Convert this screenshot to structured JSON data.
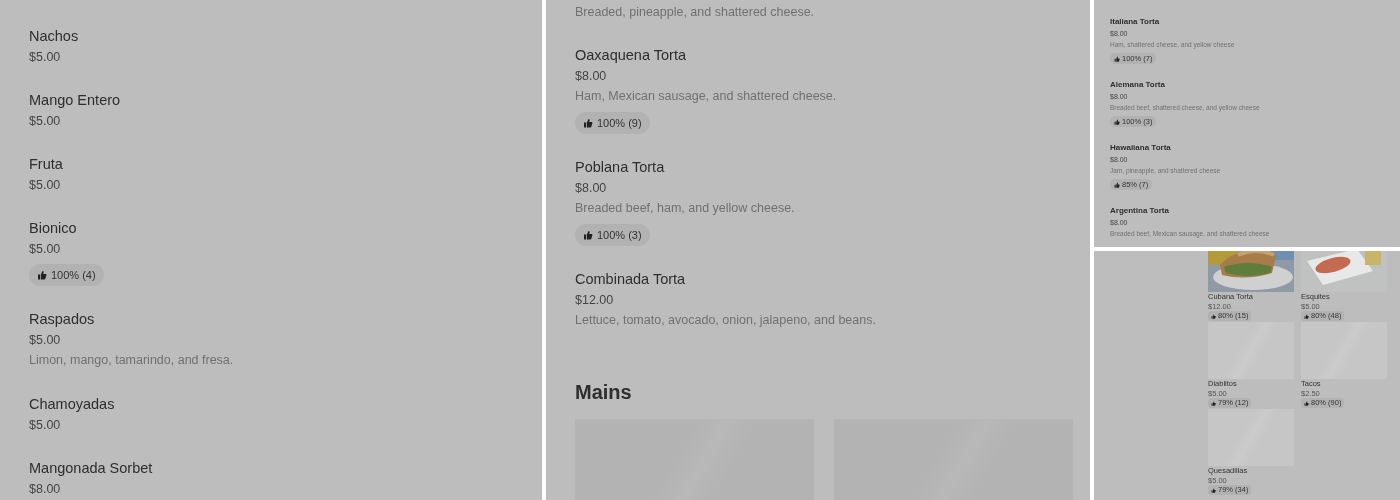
{
  "panels": [
    {
      "kind": "list",
      "items": [
        {
          "name": "Nachos",
          "price": "$5.00"
        },
        {
          "name": "Mango Entero",
          "price": "$5.00"
        },
        {
          "name": "Fruta",
          "price": "$5.00"
        },
        {
          "name": "Bionico",
          "price": "$5.00",
          "rating": "100% (4)"
        },
        {
          "name": "Raspados",
          "price": "$5.00",
          "description": "Limon, mango, tamarindo, and fresa."
        },
        {
          "name": "Chamoyadas",
          "price": "$5.00"
        },
        {
          "name": "Mangonada Sorbet",
          "price": "$8.00"
        }
      ]
    },
    {
      "kind": "list",
      "lead": "Breaded, pineapple, and shattered cheese.",
      "items": [
        {
          "name": "Oaxaquena Torta",
          "price": "$8.00",
          "description": "Ham, Mexican sausage, and shattered cheese.",
          "rating": "100% (9)"
        },
        {
          "name": "Poblana Torta",
          "price": "$8.00",
          "description": "Breaded beef, ham, and yellow cheese.",
          "rating": "100% (3)"
        },
        {
          "name": "Combinada Torta",
          "price": "$12.00",
          "description": "Lettuce, tomato, avocado, onion, jalapeno, and beans."
        }
      ],
      "section": {
        "title": "Mains"
      }
    },
    {
      "kind": "small-list",
      "items": [
        {
          "name": "Italiana Torta",
          "price": "$8.00",
          "description": "Ham, shattered cheese, and yellow cheese",
          "rating": "100% (7)"
        },
        {
          "name": "Alemana Torta",
          "price": "$8.00",
          "description": "Breaded beef, shattered cheese, and yellow cheese",
          "rating": "100% (3)"
        },
        {
          "name": "Hawaiiana Torta",
          "price": "$8.00",
          "description": "Jam, pineapple, and shattered cheese",
          "rating": "85% (7)"
        },
        {
          "name": "Argentina Torta",
          "price": "$8.00",
          "description": "Breaded beef, Mexican sausage, and shattered cheese"
        }
      ]
    },
    {
      "kind": "grid",
      "items": [
        {
          "name": "Cubana Torta",
          "price": "$12.00",
          "rating": "80% (15)"
        },
        {
          "name": "Esquites",
          "price": "$5.00",
          "rating": "80% (48)"
        },
        {
          "name": "Diablitos",
          "price": "$5.00",
          "rating": "79% (12)",
          "kind": "plain"
        },
        {
          "name": "Tacos",
          "price": "$2.50",
          "rating": "80% (90)",
          "kind": "plain"
        },
        {
          "name": "Quesadillas",
          "price": "$5.00",
          "rating": "79% (34)",
          "kind": "plain"
        }
      ]
    }
  ]
}
